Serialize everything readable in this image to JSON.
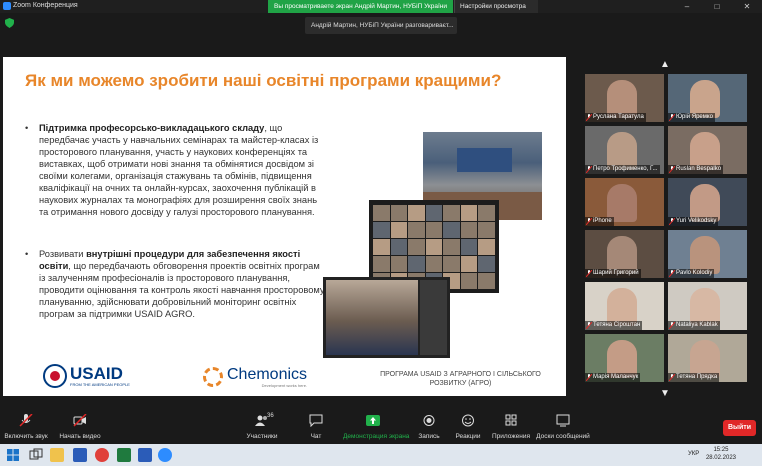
{
  "window": {
    "title": "Zoom Конференция",
    "share_banner": "Вы просматриваете экран Андрій Мартин, НУБіП України",
    "view_options": "Настройки просмотра",
    "controls": [
      "–",
      "□",
      "✕"
    ]
  },
  "speaker": {
    "label": "Андрій Мартин, НУБіП України разговариваєт..."
  },
  "slide": {
    "title": "Як ми можемо зробити наші освітні програми кращими?",
    "bullet1_bold": "Підтримка професорсько-викладацького складу",
    "bullet1_rest": ", що передбачає участь у навчальних семінарах та майстер-класах із просторового планування, участь у наукових конференціях та виставках, щоб отримати нові знання та обмінятися досвідом зі своїми колегами, організація стажувань та обмінів, підвищення кваліфікації на очних та онлайн-курсах, заохочення публікацій в наукових журналах та монографіях для розширення своїх знань та отримання нового досвіду у галузі просторового планування.",
    "bullet2_pre": "Розвивати ",
    "bullet2_bold": "внутрішні процедури для забезпечення якості освіти",
    "bullet2_rest": ", що передбачають обговорення проектів освітніх програм із залученням професіоналів із просторового планування, проводити оцінювання та контроль якості навчання просторовому плануванню, здійснювати добровільний моніторинг освітніх програм за підтримки USAID AGRO.",
    "usaid_logo": "USAID",
    "usaid_tagline": "FROM THE AMERICAN PEOPLE",
    "chemonics_logo": "Chemonics",
    "chemonics_tagline": "Development works here.",
    "program_text": "ПРОГРАМА USAID З АГРАРНОГО І СІЛЬСЬКОГО РОЗВИТКУ (АГРО)"
  },
  "gallery": {
    "participants": [
      {
        "name": "Руслана Таратула",
        "face": "#b58f7a",
        "bg": "#6c5a4c"
      },
      {
        "name": "Юрій Яремко",
        "face": "#c9a48c",
        "bg": "#556777"
      },
      {
        "name": "Петро Трофименко, Г...",
        "face": "#b89b86",
        "bg": "#6a6a6a"
      },
      {
        "name": "Ruslan Bespalko",
        "face": "#c8a08a",
        "bg": "#7a6c62"
      },
      {
        "name": "iPhone",
        "face": "#a77a68",
        "bg": "#8a5a3a"
      },
      {
        "name": "Yuri Velikodsky",
        "face": "#c29a86",
        "bg": "#404a58"
      },
      {
        "name": "Шарий Григорий",
        "face": "#a58877",
        "bg": "#5c4d42"
      },
      {
        "name": "Pavlo Kolodiy",
        "face": "#b9937d",
        "bg": "#6f8092"
      },
      {
        "name": "Тетяна Сірош­тан",
        "face": "#d3b19b",
        "bg": "#d8d2c8"
      },
      {
        "name": "Nataliya Kablak",
        "face": "#d7b8a4",
        "bg": "#cfcac2"
      },
      {
        "name": "Марія Маланчук",
        "face": "#c49c86",
        "bg": "#6b7d64"
      },
      {
        "name": "Тетяна Прядка",
        "face": "#c7a591",
        "bg": "#b0a898"
      }
    ]
  },
  "toolbar": {
    "unmute": "Включить звук",
    "start_video": "Начать видео",
    "participants": "Участники",
    "participants_count": "36",
    "chat": "Чат",
    "share": "Демонстрация экрана",
    "record": "Запись",
    "reactions": "Реакции",
    "apps": "Приложения",
    "whiteboards": "Доски сообщений",
    "leave": "Выйти"
  },
  "taskbar": {
    "lang": "УКР",
    "time": "15:25",
    "date": "28.02.2023"
  },
  "colors": {
    "accent_orange": "#e8862a",
    "share_green": "#20a346",
    "leave_red": "#e02828",
    "usaid_blue": "#003a80"
  }
}
